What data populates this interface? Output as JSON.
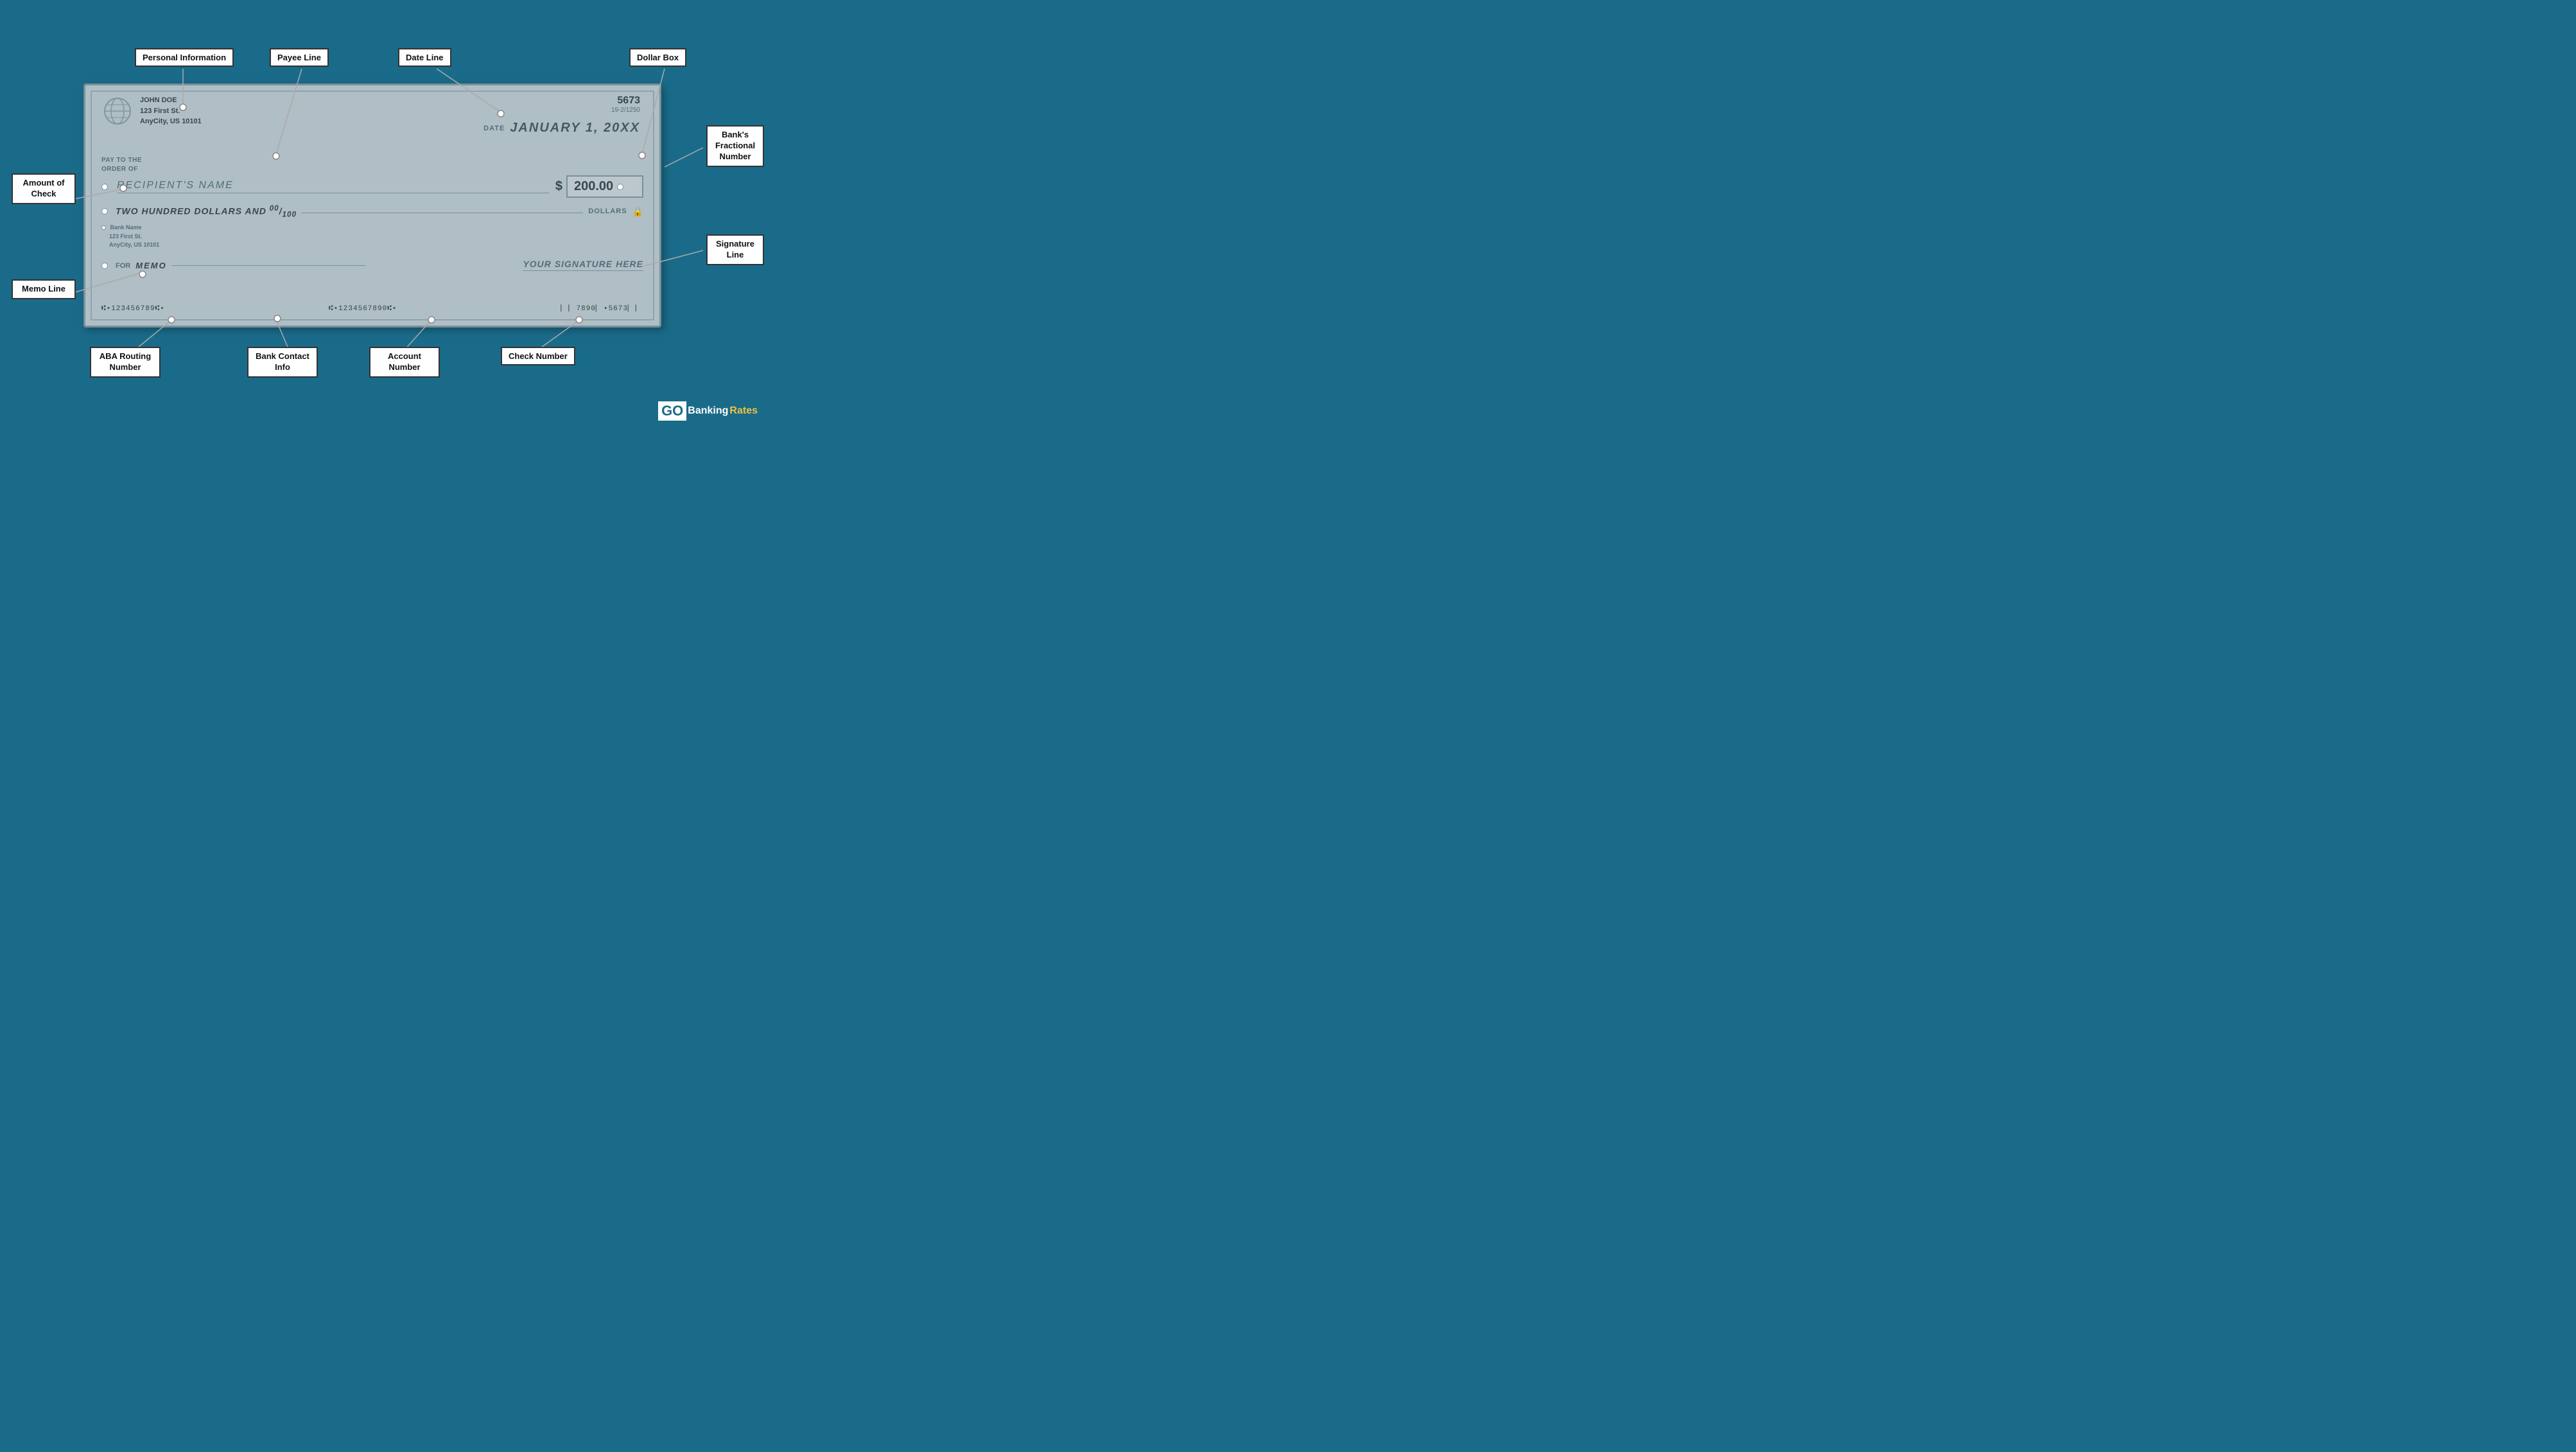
{
  "labels": {
    "personal_information": "Personal Information",
    "payee_line": "Payee Line",
    "date_line": "Date Line",
    "dollar_box": "Dollar Box",
    "amount_of_check": "Amount of Check",
    "banks_fractional_number": "Bank's Fractional Number",
    "signature_line": "Signature Line",
    "memo_line": "Memo Line",
    "aba_routing_number": "ABA Routing Number",
    "bank_contact_info": "Bank Contact Info",
    "account_number": "Account Number",
    "check_number": "Check Number"
  },
  "check": {
    "check_number": "5673",
    "fractional": "19-2/1250",
    "name": "JOHN DOE",
    "address1": "123 First St.",
    "address2": "AnyCity, US 10101",
    "date_label": "DATE",
    "date_value": "JANUARY 1, 20XX",
    "pay_to_label": "PAY TO THE\nORDER OF",
    "recipient": "RECIPIENT'S NAME",
    "dollar_sign": "$",
    "amount": "200.00",
    "written_amount": "TWO HUNDRED DOLLARS AND ⁰⁰/100",
    "dollars_label": "DOLLARS",
    "bank_name": "Bank Name",
    "bank_addr1": "123 First St.",
    "bank_addr2": "AnyCity, US 10101",
    "for_label": "FOR",
    "memo_text": "MEMO",
    "signature_text": "YOUR SIGNATURE HERE",
    "micr_routing": "Ⅱ•123456789Ⅰ•",
    "micr_account": "Ⅱ•1234567890Ⅰ•",
    "micr_check": "❘❘7890❘•5673❘❘"
  },
  "branding": {
    "go": "GO",
    "banking": "Banking",
    "rates": "Rates"
  }
}
